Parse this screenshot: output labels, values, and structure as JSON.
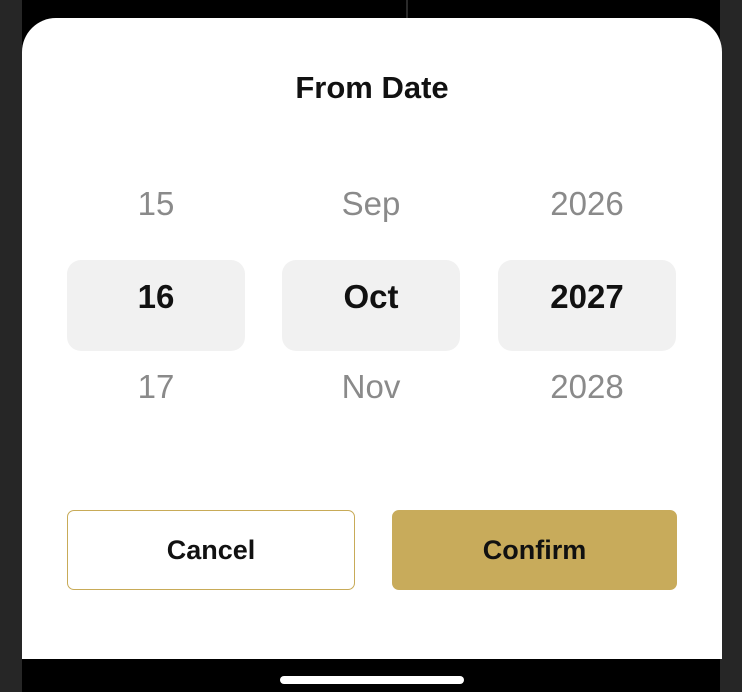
{
  "sheet": {
    "title": "From Date"
  },
  "picker": {
    "day": {
      "previous": "15",
      "selected": "16",
      "next": "17"
    },
    "month": {
      "previous": "Sep",
      "selected": "Oct",
      "next": "Nov"
    },
    "year": {
      "previous": "2026",
      "selected": "2027",
      "next": "2028"
    }
  },
  "actions": {
    "cancel_label": "Cancel",
    "confirm_label": "Confirm"
  },
  "colors": {
    "accent": "#c8ab5b",
    "selected_bg": "#f1f1f1",
    "muted_text": "#8a8a8a",
    "primary_text": "#111111"
  }
}
